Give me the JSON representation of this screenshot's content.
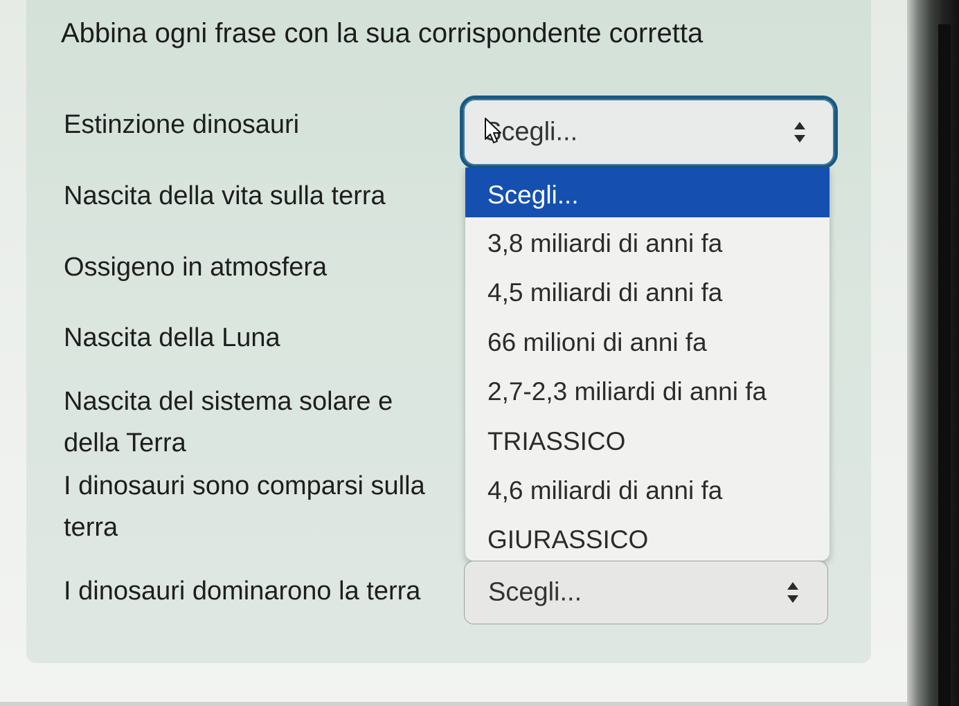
{
  "question": {
    "prompt": "Abbina ogni frase con la sua corrispondente corretta"
  },
  "stems": [
    {
      "label": "Estinzione dinosauri"
    },
    {
      "label": "Nascita della vita sulla terra"
    },
    {
      "label": "Ossigeno in atmosfera"
    },
    {
      "label": "Nascita della Luna"
    },
    {
      "label": "Nascita del sistema solare e della Terra"
    },
    {
      "label": "I dinosauri sono comparsi sulla terra"
    },
    {
      "label": "I dinosauri dominarono la terra"
    }
  ],
  "select_first": {
    "value": "Scegli..."
  },
  "select_last": {
    "value": "Scegli..."
  },
  "dropdown": {
    "options": [
      "Scegli...",
      "3,8 miliardi di anni fa",
      "4,5 miliardi di anni fa",
      "66 milioni di anni fa",
      "2,7-2,3 miliardi di anni fa",
      "TRIASSICO",
      "4,6 miliardi di anni fa",
      "GIURASSICO"
    ],
    "selected_option": "Scegli..."
  },
  "colors": {
    "highlight": "#1550b0",
    "focus_border": "#1a5a80",
    "card_background": "#d9e4dd"
  },
  "icons": {
    "select_arrows": "sort-icon",
    "pointer": "cursor-icon"
  }
}
